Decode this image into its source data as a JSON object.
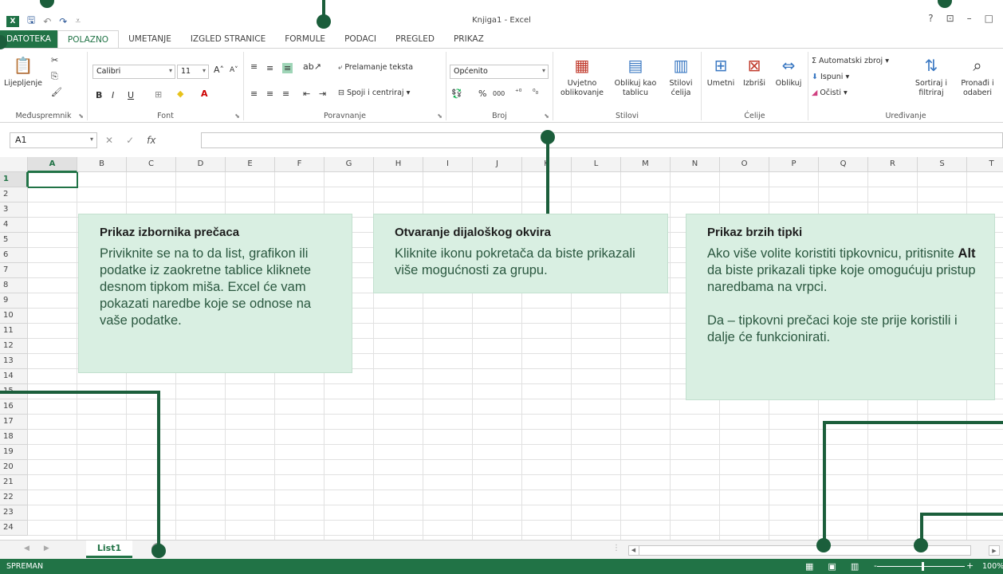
{
  "window": {
    "title": "Knjiga1 - Excel",
    "help": "?",
    "minimize": "–",
    "maximize": "□",
    "ribbon_display": "⊡"
  },
  "qat": {
    "save": "🖫",
    "undo": "↶",
    "redo": "↷",
    "customize": "⩡"
  },
  "tabs": [
    "DATOTEKA",
    "POLAZNO",
    "UMETANJE",
    "IZGLED STRANICE",
    "FORMULE",
    "PODACI",
    "PREGLED",
    "PRIKAZ"
  ],
  "active_tab": "POLAZNO",
  "ribbon": {
    "clipboard": {
      "label": "Međuspremnik",
      "paste": "Lijepljenje"
    },
    "font": {
      "label": "Font",
      "name": "Calibri",
      "size": "11",
      "bold": "B",
      "italic": "I",
      "underline": "U"
    },
    "alignment": {
      "label": "Poravnanje",
      "wrap": "Prelamanje teksta",
      "merge": "Spoji i centriraj"
    },
    "number": {
      "label": "Broj",
      "format": "Općenito",
      "percent": "%",
      "thousands": "000"
    },
    "styles": {
      "label": "Stilovi",
      "conditional": "Uvjetno oblikovanje",
      "as_table": "Oblikuj kao tablicu",
      "cell_styles": "Stilovi ćelija"
    },
    "cells": {
      "label": "Ćelije",
      "insert": "Umetni",
      "delete": "Izbriši",
      "format": "Oblikuj"
    },
    "editing": {
      "label": "Uređivanje",
      "autosum": "Automatski zbroj",
      "fill": "Ispuni",
      "clear": "Očisti",
      "sort": "Sortiraj i filtriraj",
      "find": "Pronađi i odaberi"
    }
  },
  "formula_bar": {
    "name_box": "A1",
    "fx": "fx",
    "cancel": "✕",
    "enter": "✓"
  },
  "columns": [
    "A",
    "B",
    "C",
    "D",
    "E",
    "F",
    "G",
    "H",
    "I",
    "J",
    "K",
    "L",
    "M",
    "N",
    "O",
    "P",
    "Q",
    "R",
    "S",
    "T"
  ],
  "rows": [
    "1",
    "2",
    "3",
    "4",
    "5",
    "6",
    "7",
    "8",
    "9",
    "10",
    "11",
    "12",
    "13",
    "14",
    "15",
    "16",
    "17",
    "18",
    "19",
    "20",
    "21",
    "22",
    "23",
    "24"
  ],
  "callouts": [
    {
      "title": "Prikaz izbornika prečaca",
      "body": "Priviknite se na to da list, grafikon ili podatke iz zaokretne tablice kliknete desnom tipkom miša. Excel će vam pokazati naredbe koje se odnose na vaše podatke."
    },
    {
      "title": "Otvaranje dijaloškog okvira",
      "body": "Kliknite ikonu pokretača da biste prikazali više mogućnosti za grupu."
    },
    {
      "title": "Prikaz brzih tipki",
      "body_pre": "Ako više volite koristiti tipkovnicu, pritisnite ",
      "body_key": "Alt",
      "body_post": " da biste prikazali tipke koje omogućuju pristup naredbama na vrpci.",
      "body2": "Da – tipkovni prečaci koje ste prije koristili i dalje će funkcionirati."
    }
  ],
  "sheet": {
    "tab": "List1",
    "add": "+"
  },
  "status": {
    "mode": "SPREMAN",
    "zoom": "100%",
    "minus": "-",
    "plus": "+"
  },
  "colors": {
    "excel_green": "#217346",
    "callout_bg": "#d9efe2",
    "annotation": "#1b5e3b"
  }
}
